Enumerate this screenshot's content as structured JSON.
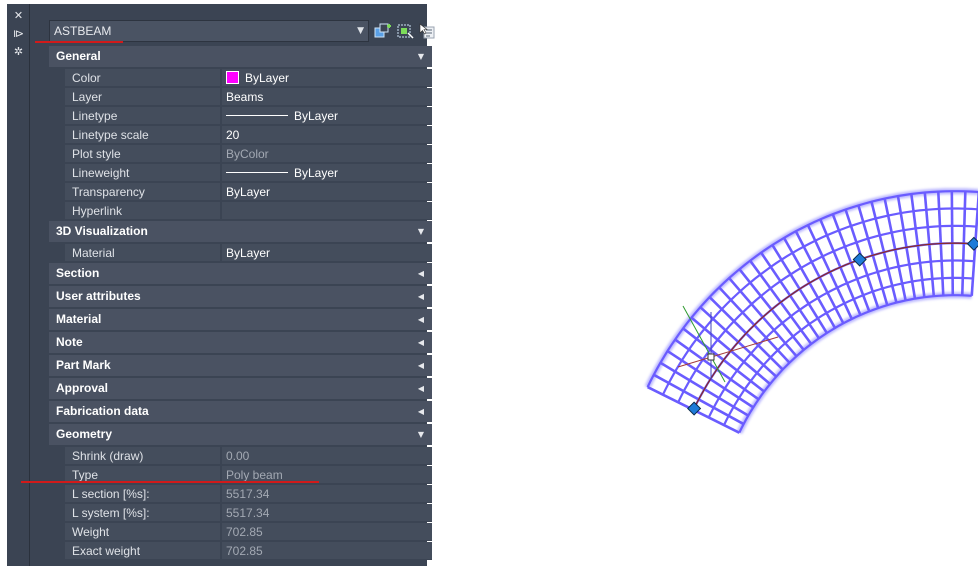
{
  "palette": {
    "object_type": "ASTBEAM",
    "side_icons": {
      "close": "close-icon",
      "pin": "auto-hide-icon",
      "settings": "properties-settings-icon"
    },
    "toolbar_icons": [
      "quick-select-icon",
      "select-objects-icon",
      "toggle-pickadd-icon"
    ],
    "categories": [
      {
        "name": "General",
        "expanded": true,
        "rows": [
          {
            "name": "Color",
            "value": "ByLayer",
            "swatch": "#ff00ff"
          },
          {
            "name": "Layer",
            "value": "Beams"
          },
          {
            "name": "Linetype",
            "value": "ByLayer",
            "line": true
          },
          {
            "name": "Linetype scale",
            "value": "20"
          },
          {
            "name": "Plot style",
            "value": "ByColor",
            "dim": true
          },
          {
            "name": "Lineweight",
            "value": "ByLayer",
            "line": true
          },
          {
            "name": "Transparency",
            "value": "ByLayer"
          },
          {
            "name": "Hyperlink",
            "value": ""
          }
        ]
      },
      {
        "name": "3D Visualization",
        "expanded": true,
        "rows": [
          {
            "name": "Material",
            "value": "ByLayer"
          }
        ]
      },
      {
        "name": "Section",
        "expanded": false,
        "rows": []
      },
      {
        "name": "User attributes",
        "expanded": false,
        "rows": []
      },
      {
        "name": "Material",
        "expanded": false,
        "rows": []
      },
      {
        "name": "Note",
        "expanded": false,
        "rows": []
      },
      {
        "name": "Part Mark",
        "expanded": false,
        "rows": []
      },
      {
        "name": "Approval",
        "expanded": false,
        "rows": []
      },
      {
        "name": "Fabrication data",
        "expanded": false,
        "rows": []
      },
      {
        "name": "Geometry",
        "expanded": true,
        "rows": [
          {
            "name": "Shrink (draw)",
            "value": "0.00",
            "dim": true
          },
          {
            "name": "Type",
            "value": "Poly beam",
            "dim": true
          },
          {
            "name": "L section [%s]:",
            "value": "5517.34",
            "dim": true
          },
          {
            "name": "L system [%s]:",
            "value": "5517.34",
            "dim": true
          },
          {
            "name": "Weight",
            "value": "702.85",
            "dim": true
          },
          {
            "name": "Exact weight",
            "value": "702.85",
            "dim": true
          }
        ]
      }
    ]
  },
  "annotations": {
    "highlight_color": "#d11a1a"
  },
  "viewport": {
    "beam_color": "#6a5cff",
    "beam_glow": "#a9a4ff",
    "grip_color": "#1e7bd8",
    "centerline_color": "#8a2b2b",
    "ucs_x_color": "#a33a3a",
    "ucs_y_color": "#2f9a2f",
    "ucs_z_color": "#4040c0"
  }
}
